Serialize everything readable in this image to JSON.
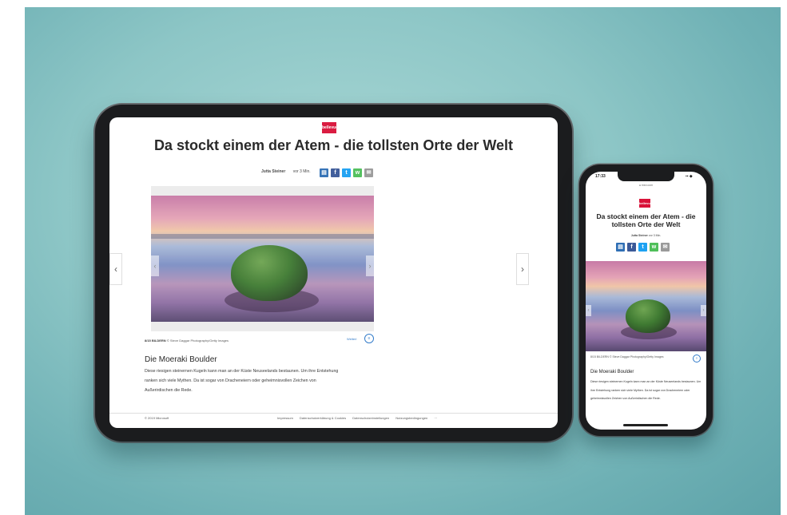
{
  "brand": {
    "name": "bellevue",
    "logo_text": "bellevue",
    "color": "#d9133a"
  },
  "article": {
    "title": "Da stockt einem der Atem - die tollsten Orte der Welt",
    "title_phone": "Da stockt einem der Atem - die tollsten Orte der Welt",
    "author": "Jutta Steiner",
    "time": "vor 3 Min.",
    "share": [
      {
        "icon": "flipboard-icon",
        "glyph": "▤",
        "color": "#2f6fb5"
      },
      {
        "icon": "facebook-icon",
        "glyph": "f",
        "color": "#3b5998"
      },
      {
        "icon": "twitter-icon",
        "glyph": "t",
        "color": "#1da1f2"
      },
      {
        "icon": "whatsapp-icon",
        "glyph": "w",
        "color": "#4fbf5a"
      },
      {
        "icon": "mail-icon",
        "glyph": "✉",
        "color": "#9a9a9a"
      }
    ],
    "caption_label": "8/15 BILDERN",
    "caption_credit": "© Steve Daggar Photography/Getty Images",
    "caption_more": "Weiterl",
    "heading": "Die Moeraki Boulder",
    "body": "Diese riesigen steinernen Kugeln kann man an der Küste Neuseelands bestaunen. Um ihre Entstehung ranken sich viele Mythen. Da ist sogar von Dracheneiern oder geheimnisvollen Zeichen von Außerirdischen die Rede."
  },
  "nav": {
    "prev": "‹",
    "next": "›"
  },
  "footer": {
    "copyright": "© 2019 Microsoft",
    "links": [
      "Impressum",
      "Datenschutzerklärung & Cookies",
      "Datenschutzeinstellungen",
      "Nutzungsbedingungen",
      "···"
    ]
  },
  "phone": {
    "time": "17:33",
    "signal": "▪▪ ◆",
    "url": "● msn.com",
    "caption": "8/15 BILDERN © Steve Daggar Photography/Getty Images"
  }
}
